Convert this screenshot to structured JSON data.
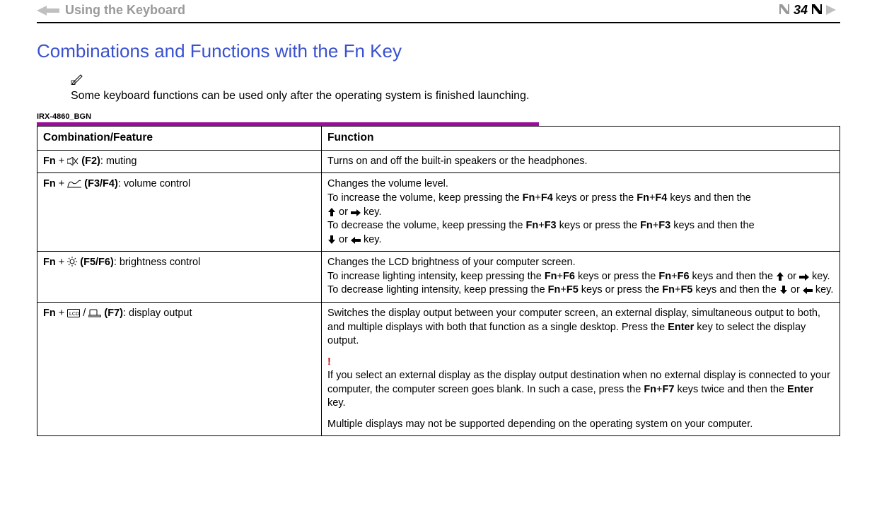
{
  "header": {
    "section_title": "Using the Keyboard",
    "page_number": "34"
  },
  "title": "Combinations and Functions with the Fn Key",
  "note": {
    "text": "Some keyboard functions can be used only after the operating system is finished launching."
  },
  "code_label": "IRX-4860_BGN",
  "table": {
    "head": [
      "Combination/Feature",
      "Function"
    ],
    "rows": [
      {
        "combo_prefix": "Fn",
        "combo_suffix": " (F2)",
        "combo_desc": ": muting",
        "icon": "mute-icon",
        "func_main": "Turns on and off the built-in speakers or the headphones."
      },
      {
        "combo_prefix": "Fn",
        "combo_suffix": " (F3/F4)",
        "combo_desc": ": volume control",
        "icon": "volume-icon",
        "func_main": "Changes the volume level.",
        "inc_a": "To increase the volume, keep pressing the ",
        "inc_k1": "Fn",
        "inc_plus1": "+",
        "inc_k2": "F4",
        "inc_b": " keys or press the ",
        "inc_k3": "Fn",
        "inc_plus2": "+",
        "inc_k4": "F4",
        "inc_c": " keys and then the ",
        "inc_or": " or ",
        "inc_end": " key.",
        "dec_a": "To decrease the volume, keep pressing the ",
        "dec_k1": "Fn",
        "dec_plus1": "+",
        "dec_k2": "F3",
        "dec_b": " keys or press the ",
        "dec_k3": "Fn",
        "dec_plus2": "+",
        "dec_k4": "F3",
        "dec_c": " keys and then the ",
        "dec_or": " or ",
        "dec_end": " key."
      },
      {
        "combo_prefix": "Fn",
        "combo_suffix": " (F5/F6)",
        "combo_desc": ": brightness control",
        "icon": "brightness-icon",
        "func_main": "Changes the LCD brightness of your computer screen.",
        "inc_a": "To increase lighting intensity, keep pressing the ",
        "inc_k1": "Fn",
        "inc_plus1": "+",
        "inc_k2": "F6",
        "inc_b": " keys or press the ",
        "inc_k3": "Fn",
        "inc_plus2": "+",
        "inc_k4": "F6",
        "inc_c": " keys and then the ",
        "inc_or": " or ",
        "inc_end": " key.",
        "dec_a": "To decrease lighting intensity, keep pressing the ",
        "dec_k1": "Fn",
        "dec_plus1": "+",
        "dec_k2": "F5",
        "dec_b": " keys or press the ",
        "dec_k3": "Fn",
        "dec_plus2": "+",
        "dec_k4": "F5",
        "dec_c": " keys and then the ",
        "dec_or": " or ",
        "dec_end": " key."
      },
      {
        "combo_prefix": "Fn",
        "combo_suffix": " (F7)",
        "combo_desc": ": display output",
        "icon": "display-icon",
        "func_main_a": "Switches the display output between your computer screen, an external display, simultaneous output to both, and multiple displays with both that function as a single desktop. Press the ",
        "func_enter": "Enter",
        "func_main_b": " key to select the display output.",
        "warn_mark": "!",
        "warn_a": "If you select an external display as the display output destination when no external display is connected to your computer, the computer screen goes blank. In such a case, press the ",
        "warn_k1": "Fn",
        "warn_plus": "+",
        "warn_k2": "F7",
        "warn_b": " keys twice and then the ",
        "warn_enter": "Enter",
        "warn_c": " key.",
        "tail": "Multiple displays may not be supported depending on the operating system on your computer."
      }
    ]
  }
}
